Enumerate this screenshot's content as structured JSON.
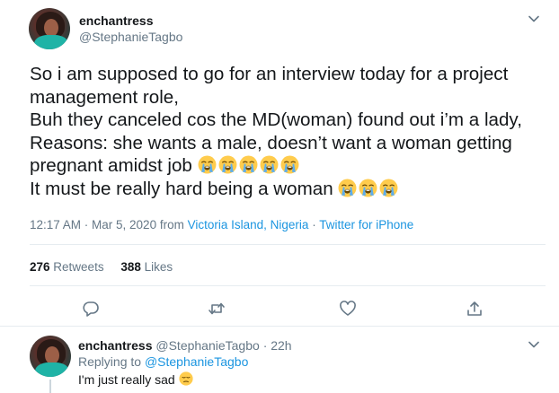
{
  "tweet": {
    "author_name": "enchantress",
    "author_handle": "@StephanieTagbo",
    "text_lines": [
      "So i am supposed to go for an interview today for a project",
      "management role,",
      "Buh they canceled cos the MD(woman) found out i’m a lady,",
      "Reasons: she wants a male, doesn’t want a woman getting",
      "pregnant amidst job",
      "It must be really hard being a woman"
    ],
    "emoji_line4_count": 5,
    "emoji_line5_count": 3,
    "emoji_name": "loudly-crying-face-icon",
    "time": "12:17 AM · Mar 5, 2020",
    "from_label": "from",
    "location": "Victoria Island, Nigeria",
    "separator": "·",
    "client": "Twitter for iPhone",
    "retweets_count": "276",
    "retweets_label": "Retweets",
    "likes_count": "388",
    "likes_label": "Likes"
  },
  "actions": {
    "icons": [
      "reply-icon",
      "retweet-icon",
      "like-icon",
      "share-icon"
    ]
  },
  "reply": {
    "author_name": "enchantress",
    "author_handle": "@StephanieTagbo",
    "time": "· 22h",
    "replying_label": "Replying to",
    "replying_to": "@StephanieTagbo",
    "text": "I'm just really sad",
    "emoji_name": "pensive-face-icon"
  },
  "colors": {
    "text": "#14171a",
    "secondary": "#657786",
    "link": "#1b95e0",
    "divider": "#e6ecf0"
  }
}
